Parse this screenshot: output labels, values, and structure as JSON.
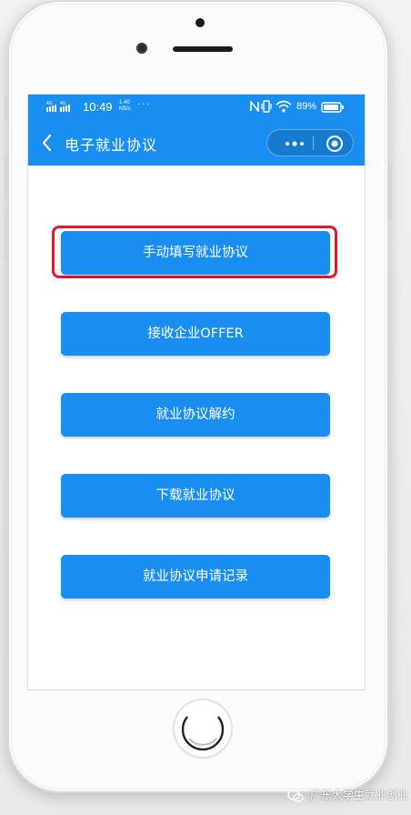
{
  "status_bar": {
    "network_label": "4G 4G",
    "time": "10:49",
    "net_speed_value": "1.40",
    "net_speed_unit": "KB/s",
    "more_dots": "···",
    "battery_percent": "89%"
  },
  "nav": {
    "title": "电子就业协议",
    "more_icon": "more-dots-icon",
    "close_icon": "target-circle-icon"
  },
  "menu": {
    "items": [
      {
        "label": "手动填写就业协议"
      },
      {
        "label": "接收企业OFFER"
      },
      {
        "label": "就业协议解约"
      },
      {
        "label": "下载就业协议"
      },
      {
        "label": "就业协议申请记录"
      }
    ]
  },
  "watermark": {
    "text": "广东大学生就业创业"
  },
  "colors": {
    "primary": "#1a8ef0",
    "highlight": "#e0182d"
  }
}
